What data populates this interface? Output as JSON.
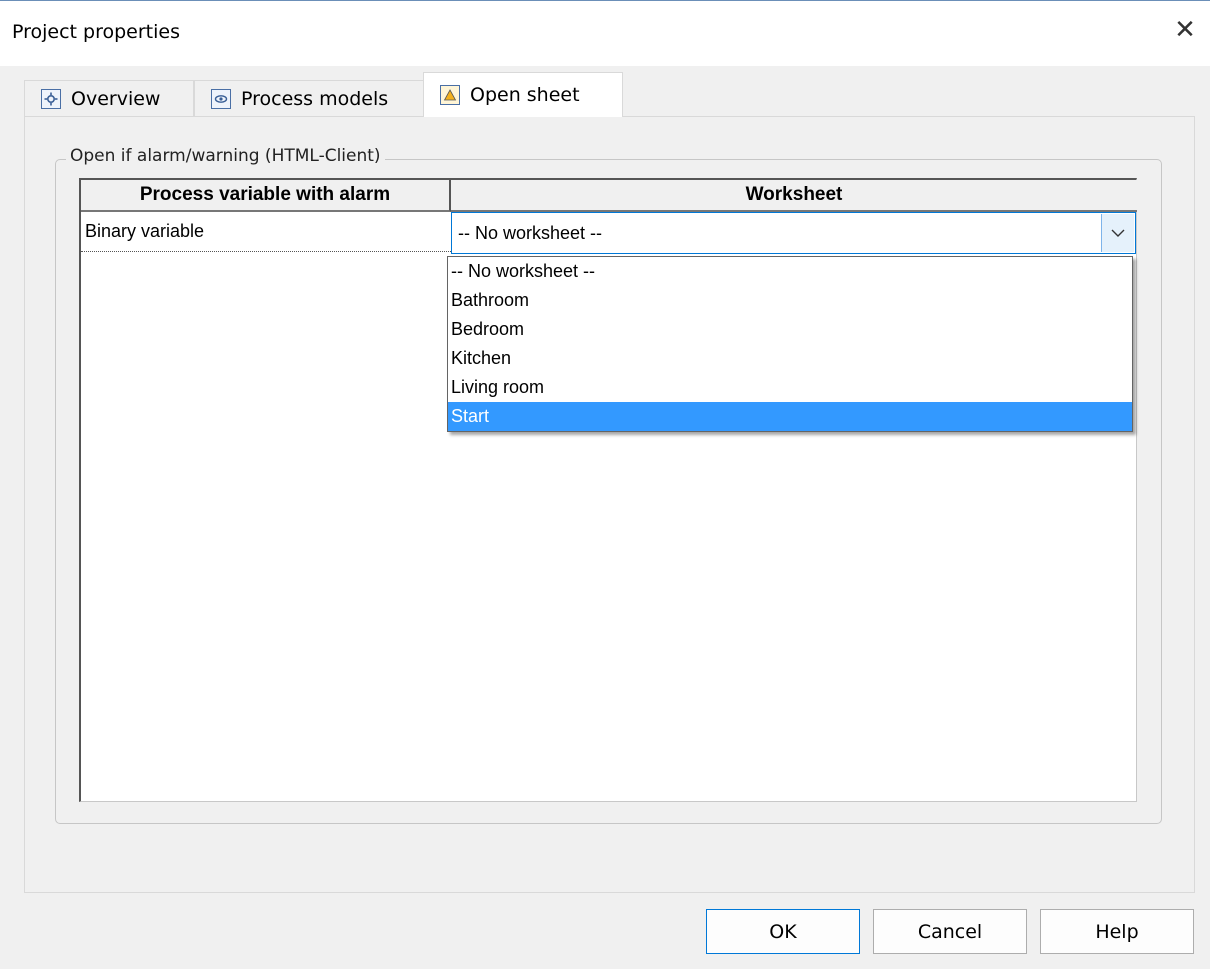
{
  "window": {
    "title": "Project properties",
    "close_glyph": "✕"
  },
  "tabs": [
    {
      "label": "Overview",
      "icon": "gear-icon"
    },
    {
      "label": "Process models",
      "icon": "eye-icon"
    },
    {
      "label": "Open sheet",
      "icon": "triangle-sheet-icon",
      "active": true
    }
  ],
  "group": {
    "label": "Open if alarm/warning (HTML-Client)",
    "table": {
      "headers": [
        "Process variable with alarm",
        "Worksheet"
      ],
      "rows": [
        {
          "variable": "Binary variable",
          "worksheet": "-- No worksheet --"
        }
      ]
    },
    "dropdown": {
      "options": [
        "-- No worksheet --",
        "Bathroom",
        "Bedroom",
        "Kitchen",
        "Living room",
        "Start"
      ],
      "highlighted": "Start"
    }
  },
  "buttons": {
    "ok": "OK",
    "cancel": "Cancel",
    "help": "Help"
  },
  "colors": {
    "accent": "#0078d7",
    "selection": "#3399ff"
  }
}
